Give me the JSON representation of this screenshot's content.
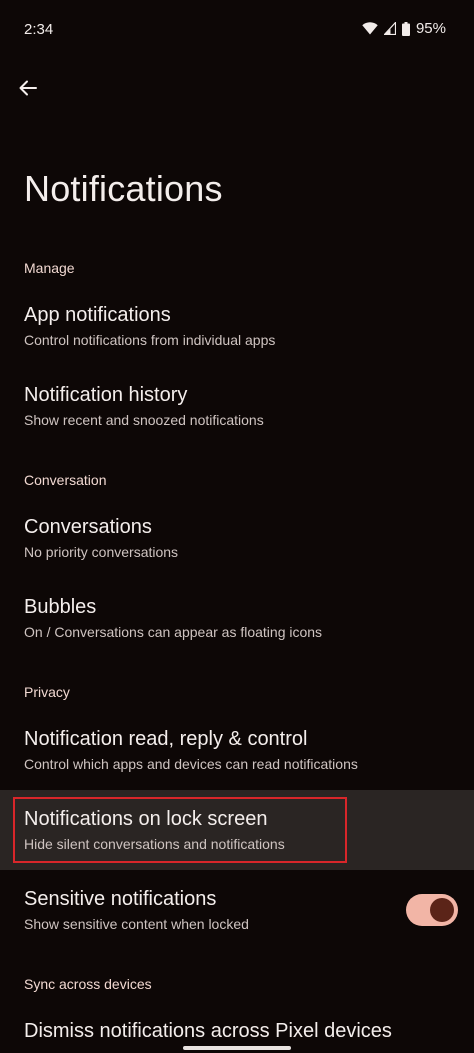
{
  "status_bar": {
    "time": "2:34",
    "battery": "95%",
    "icons": [
      "wifi-icon",
      "signal-icon",
      "battery-icon"
    ]
  },
  "page": {
    "title": "Notifications"
  },
  "sections": {
    "manage": {
      "header": "Manage",
      "items": [
        {
          "title": "App notifications",
          "subtitle": "Control notifications from individual apps"
        },
        {
          "title": "Notification history",
          "subtitle": "Show recent and snoozed notifications"
        }
      ]
    },
    "conversation": {
      "header": "Conversation",
      "items": [
        {
          "title": "Conversations",
          "subtitle": "No priority conversations"
        },
        {
          "title": "Bubbles",
          "subtitle": "On / Conversations can appear as floating icons"
        }
      ]
    },
    "privacy": {
      "header": "Privacy",
      "items": [
        {
          "title": "Notification read, reply & control",
          "subtitle": "Control which apps and devices can read notifications"
        },
        {
          "title": "Notifications on lock screen",
          "subtitle": "Hide silent conversations and notifications"
        },
        {
          "title": "Sensitive notifications",
          "subtitle": "Show sensitive content when locked",
          "toggle_on": true
        }
      ]
    },
    "sync": {
      "header": "Sync across devices",
      "items": [
        {
          "title": "Dismiss notifications across Pixel devices"
        }
      ]
    }
  },
  "colors": {
    "background": "#0d0706",
    "highlight": "#2a2523",
    "outline": "#d8262a",
    "toggle_track": "#f2b5a6",
    "toggle_thumb": "#5b2418"
  }
}
